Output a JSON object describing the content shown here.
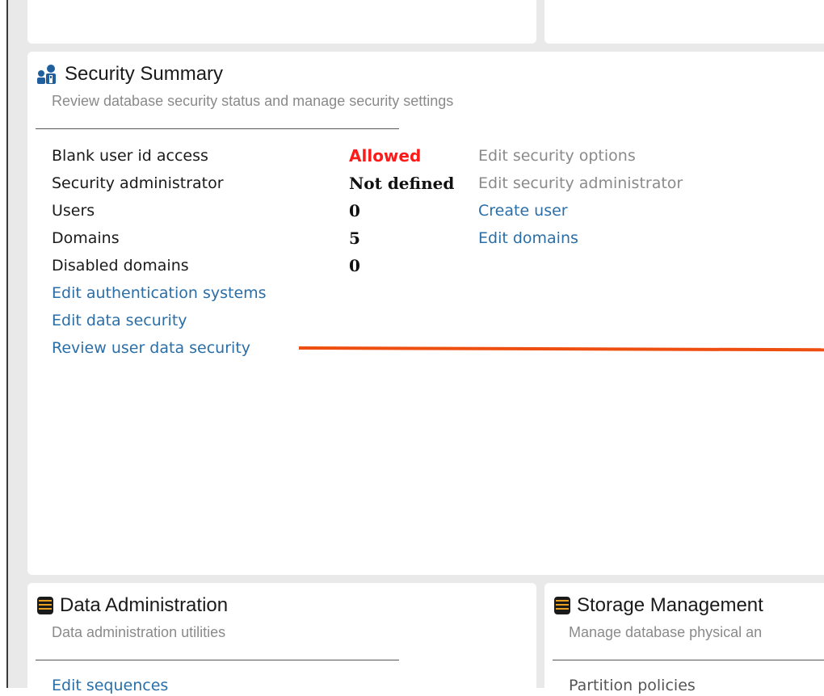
{
  "security": {
    "title": "Security Summary",
    "subtitle": "Review database security status and manage security settings",
    "rows": [
      {
        "label": "Blank user id access",
        "value": "Allowed",
        "action": "Edit security options"
      },
      {
        "label": "Security administrator",
        "value": "Not defined",
        "action": "Edit security administrator"
      },
      {
        "label": "Users",
        "value": "0",
        "action": "Create user"
      },
      {
        "label": "Domains",
        "value": "5",
        "action": "Edit domains"
      },
      {
        "label": "Disabled domains",
        "value": "0"
      }
    ],
    "links": [
      "Edit authentication systems",
      "Edit data security",
      "Review user data security"
    ],
    "icon": "users-icon",
    "value_alert_color": "#ff1a1a",
    "link_color": "#2a6ea8",
    "annotation_color": "#ee4f10"
  },
  "data_admin": {
    "title": "Data Administration",
    "subtitle": "Data administration utilities",
    "first_link": "Edit sequences",
    "icon": "database-icon"
  },
  "storage": {
    "title": "Storage Management",
    "subtitle": "Manage database physical an",
    "first_link": "Partition policies",
    "icon": "database-icon"
  }
}
